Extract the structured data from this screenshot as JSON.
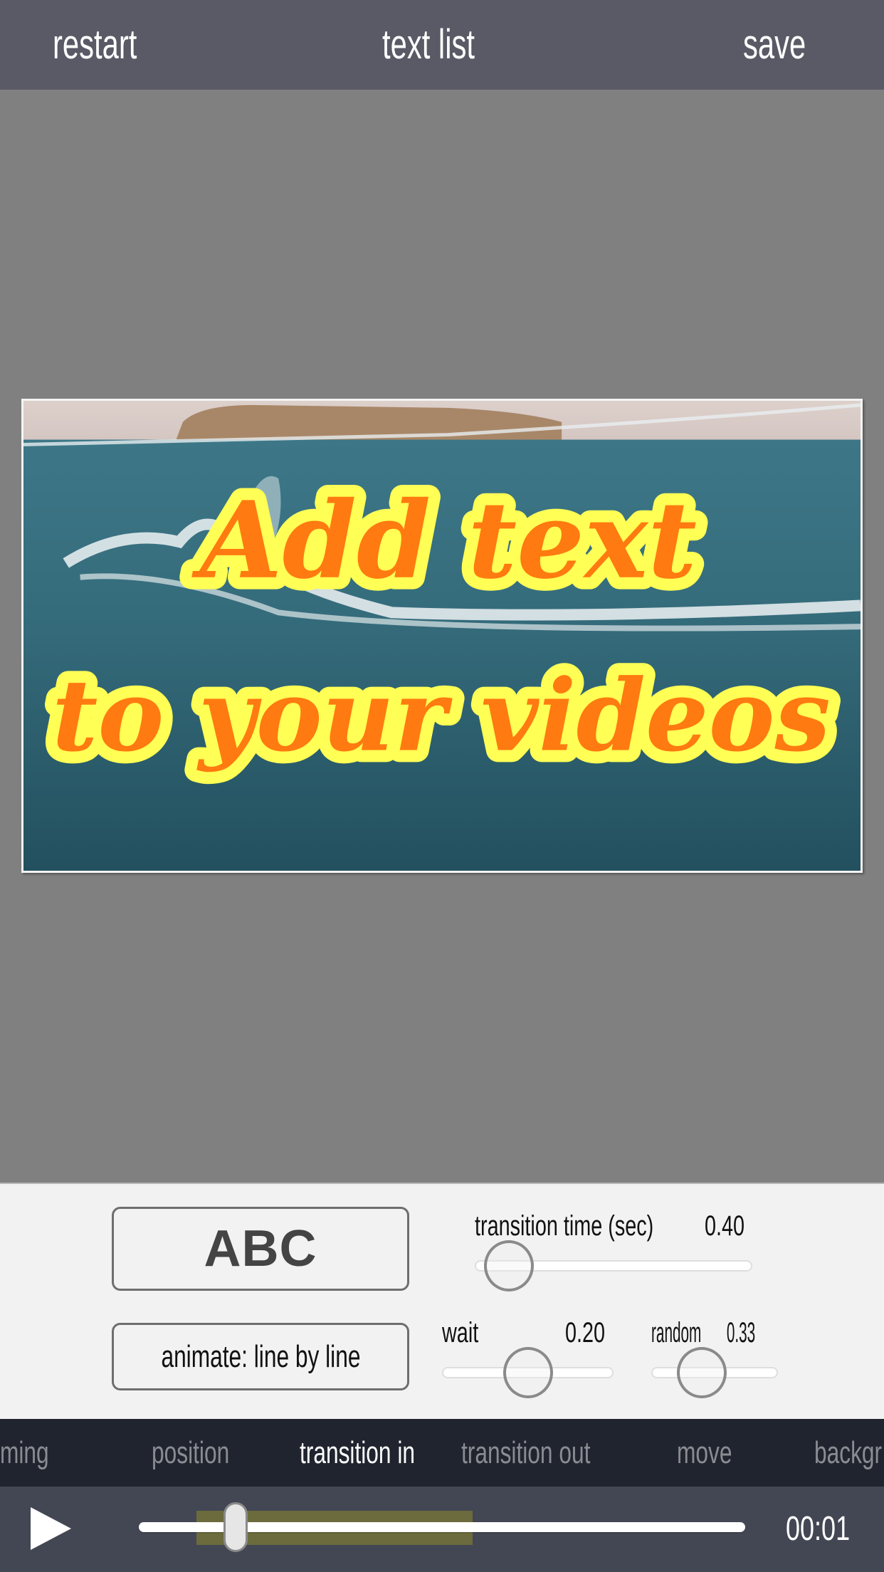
{
  "topbar": {
    "restart_label": "restart",
    "text_list_label": "text list",
    "save_label": "save",
    "background_color": "#5a5a66"
  },
  "preview": {
    "overlay_lines": [
      "Add text",
      "to your videos"
    ],
    "text_fill_color": "#ff7a10",
    "text_outline_color": "#ffff55",
    "background_scene": "ocean-wave-video-frame"
  },
  "controls": {
    "style_preview_label": "ABC",
    "animate_button_label": "animate: line by line",
    "transition_time": {
      "label": "transition time (sec)",
      "value_text": "0.40",
      "fraction": 0.04
    },
    "wait": {
      "label": "wait",
      "value_text": "0.20",
      "fraction": 0.5
    },
    "random": {
      "label": "random",
      "value_text": "0.33",
      "fraction": 0.33
    }
  },
  "tabs": [
    {
      "label": "timing",
      "visible_text": "ming",
      "active": false
    },
    {
      "label": "position",
      "active": false
    },
    {
      "label": "transition in",
      "active": true
    },
    {
      "label": "transition out",
      "active": false
    },
    {
      "label": "move",
      "active": false
    },
    {
      "label": "background",
      "visible_text": "backgr",
      "active": false
    }
  ],
  "player": {
    "play_icon": "play-icon",
    "current_time": "00:01",
    "playhead_fraction": 0.16,
    "text_range_start_fraction": 0.095,
    "text_range_end_fraction": 0.55,
    "range_color": "#6b6b3d"
  }
}
